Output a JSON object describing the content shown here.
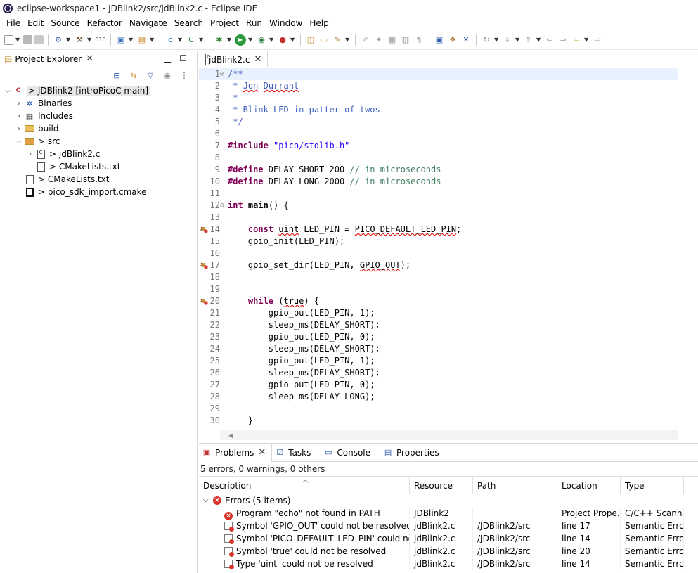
{
  "window": {
    "title": "eclipse-workspace1 - JDBlink2/src/jdBlink2.c - Eclipse IDE"
  },
  "menu": [
    "File",
    "Edit",
    "Source",
    "Refactor",
    "Navigate",
    "Search",
    "Project",
    "Run",
    "Window",
    "Help"
  ],
  "project_explorer": {
    "tab_label": "Project Explorer",
    "tree": [
      {
        "label": "> JDBlink2 [introPicoC main]",
        "depth": 0,
        "expanded": true,
        "icon": "c-project-icon",
        "selected": true
      },
      {
        "label": "Binaries",
        "depth": 1,
        "expanded": false,
        "icon": "binaries-icon"
      },
      {
        "label": "Includes",
        "depth": 1,
        "expanded": false,
        "icon": "includes-icon"
      },
      {
        "label": "build",
        "depth": 1,
        "expanded": false,
        "icon": "folder-icon"
      },
      {
        "label": "> src",
        "depth": 1,
        "expanded": true,
        "icon": "source-folder-icon"
      },
      {
        "label": "> jdBlink2.c",
        "depth": 2,
        "expanded": false,
        "icon": "c-file-icon"
      },
      {
        "label": "> CMakeLists.txt",
        "depth": 2,
        "expanded": null,
        "icon": "text-file-icon"
      },
      {
        "label": "> CMakeLists.txt",
        "depth": 1,
        "expanded": null,
        "icon": "text-file-icon"
      },
      {
        "label": "> pico_sdk_import.cmake",
        "depth": 1,
        "expanded": null,
        "icon": "cmake-file-icon"
      }
    ]
  },
  "editor": {
    "tab_label": "jdBlink2.c",
    "lines": [
      {
        "n": "1",
        "fold": "⊖",
        "html_class": "c-comment",
        "text": "/**",
        "current": true
      },
      {
        "n": "2",
        "text": " * Jon Durrant",
        "kind": "comment-squig"
      },
      {
        "n": "3",
        "text": " *",
        "kind": "comment"
      },
      {
        "n": "4",
        "text": " * Blink LED in patter of twos",
        "kind": "comment"
      },
      {
        "n": "5",
        "text": " */",
        "kind": "comment"
      },
      {
        "n": "6",
        "text": ""
      },
      {
        "n": "7",
        "kind": "include",
        "kw": "#include",
        "str": " \"pico/stdlib.h\""
      },
      {
        "n": "8",
        "text": ""
      },
      {
        "n": "9",
        "kind": "define",
        "kw": "#define",
        "body": " DELAY_SHORT 200 ",
        "comment": "// in microseconds"
      },
      {
        "n": "10",
        "kind": "define",
        "kw": "#define",
        "body": " DELAY_LONG 2000 ",
        "comment": "// in microseconds"
      },
      {
        "n": "11",
        "text": ""
      },
      {
        "n": "12",
        "fold": "⊖",
        "kind": "main",
        "kw": "int",
        "fn": " main",
        "rest": "() {"
      },
      {
        "n": "13",
        "text": ""
      },
      {
        "n": "14",
        "mark": true,
        "kind": "const"
      },
      {
        "n": "15",
        "text": "    gpio_init(LED_PIN);"
      },
      {
        "n": "16",
        "text": ""
      },
      {
        "n": "17",
        "mark": true,
        "kind": "setdir"
      },
      {
        "n": "18",
        "text": ""
      },
      {
        "n": "19",
        "text": ""
      },
      {
        "n": "20",
        "mark": true,
        "kind": "while"
      },
      {
        "n": "21",
        "text": "        gpio_put(LED_PIN, 1);"
      },
      {
        "n": "22",
        "text": "        sleep_ms(DELAY_SHORT);"
      },
      {
        "n": "23",
        "text": "        gpio_put(LED_PIN, 0);"
      },
      {
        "n": "24",
        "text": "        sleep_ms(DELAY_SHORT);"
      },
      {
        "n": "25",
        "text": "        gpio_put(LED_PIN, 1);"
      },
      {
        "n": "26",
        "text": "        sleep_ms(DELAY_SHORT);"
      },
      {
        "n": "27",
        "text": "        gpio_put(LED_PIN, 0);"
      },
      {
        "n": "28",
        "text": "        sleep_ms(DELAY_LONG);"
      },
      {
        "n": "29",
        "text": ""
      },
      {
        "n": "30",
        "text": "    }"
      }
    ],
    "tokens": {
      "const_kw": "const",
      "uint": "uint",
      "led_decl": " LED_PIN = ",
      "pico_default": "PICO_DEFAULT_LED_PIN",
      "semi": ";",
      "setdir_head": "gpio_set_dir(LED_PIN, ",
      "gpio_out": "GPIO_OUT",
      "setdir_tail": ");",
      "while_kw": "while",
      "true_kw": "true",
      "while_tail": ") {"
    }
  },
  "bottom": {
    "tabs": [
      {
        "label": "Problems",
        "icon": "problems-icon",
        "active": true
      },
      {
        "label": "Tasks",
        "icon": "tasks-icon"
      },
      {
        "label": "Console",
        "icon": "console-icon"
      },
      {
        "label": "Properties",
        "icon": "properties-icon"
      }
    ],
    "summary": "5 errors, 0 warnings, 0 others",
    "columns": [
      "Description",
      "Resource",
      "Path",
      "Location",
      "Type"
    ],
    "group_label": "Errors (5 items)",
    "rows": [
      {
        "desc": "Program \"echo\" not found in PATH",
        "resource": "JDBlink2",
        "path": "",
        "location": "Project Prope...",
        "type": "C/C++ Scann...",
        "icon": "error"
      },
      {
        "desc": "Symbol 'GPIO_OUT' could not be resolved",
        "resource": "jdBlink2.c",
        "path": "/JDBlink2/src",
        "location": "line 17",
        "type": "Semantic Error",
        "icon": "file-error"
      },
      {
        "desc": "Symbol 'PICO_DEFAULT_LED_PIN' could not be resolved",
        "resource": "jdBlink2.c",
        "path": "/JDBlink2/src",
        "location": "line 14",
        "type": "Semantic Error",
        "icon": "file-error"
      },
      {
        "desc": "Symbol 'true' could not be resolved",
        "resource": "jdBlink2.c",
        "path": "/JDBlink2/src",
        "location": "line 20",
        "type": "Semantic Error",
        "icon": "file-error"
      },
      {
        "desc": "Type 'uint' could not be resolved",
        "resource": "jdBlink2.c",
        "path": "/JDBlink2/src",
        "location": "line 14",
        "type": "Semantic Error",
        "icon": "file-error"
      }
    ]
  },
  "colors": {
    "comment": "#3f5fbf",
    "keyword": "#7f0055",
    "string": "#2a00ff",
    "line_comment": "#3f7f5f",
    "error": "#d9342b",
    "current_line": "#e8f2fe"
  }
}
